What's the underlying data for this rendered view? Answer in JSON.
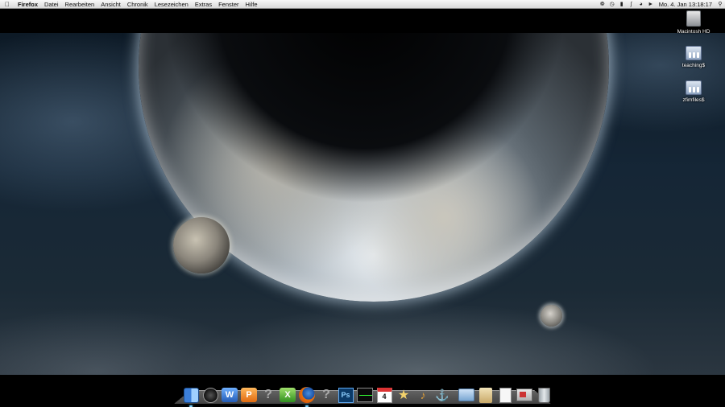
{
  "menubar": {
    "apple_icon": "apple-logo",
    "items": [
      {
        "label": "Firefox",
        "bold": true
      },
      {
        "label": "Datei"
      },
      {
        "label": "Rearbeiten"
      },
      {
        "label": "Ansicht"
      },
      {
        "label": "Chronik"
      },
      {
        "label": "Lesezeichen"
      },
      {
        "label": "Extras"
      },
      {
        "label": "Fenster"
      },
      {
        "label": "Hilfe"
      }
    ],
    "status_icons": [
      "script-icon",
      "time-machine-icon",
      "battery-icon",
      "bluetooth-icon",
      "wifi-icon",
      "volume-icon"
    ],
    "clock": "Mo. 4. Jan  13:18:17",
    "spotlight_icon": "spotlight-search-icon"
  },
  "desktop_icons": [
    {
      "label": "Macintosh HD",
      "icon": "hard-drive-icon"
    },
    {
      "label": "teaching$",
      "icon": "network-drive-icon"
    },
    {
      "label": "zfimfiles$",
      "icon": "network-drive-icon"
    }
  ],
  "dock": {
    "items": [
      {
        "name": "finder",
        "icon": "finder-icon",
        "running": true
      },
      {
        "name": "dashboard",
        "icon": "dashboard-icon",
        "running": false
      },
      {
        "name": "word",
        "icon": "word-icon",
        "glyph": "W",
        "running": false
      },
      {
        "name": "pages",
        "icon": "pages-icon",
        "glyph": "P",
        "running": false
      },
      {
        "name": "unknown-app-1",
        "icon": "question-mark-icon",
        "glyph": "?",
        "running": false
      },
      {
        "name": "excel",
        "icon": "excel-icon",
        "glyph": "X",
        "running": false
      },
      {
        "name": "firefox",
        "icon": "firefox-icon",
        "running": true
      },
      {
        "name": "unknown-app-2",
        "icon": "question-mark-icon",
        "glyph": "?",
        "running": false
      },
      {
        "name": "photoshop",
        "icon": "photoshop-icon",
        "glyph": "Ps",
        "running": false
      },
      {
        "name": "activity-monitor",
        "icon": "activity-monitor-icon",
        "running": false
      },
      {
        "name": "ical",
        "icon": "calendar-icon",
        "glyph": "4",
        "running": false
      },
      {
        "name": "imovie",
        "icon": "star-icon",
        "glyph": "★",
        "running": false
      },
      {
        "name": "garageband",
        "icon": "guitar-icon",
        "glyph": "♪",
        "running": false
      },
      {
        "name": "utility",
        "icon": "compass-icon",
        "glyph": "⚓",
        "running": false
      },
      {
        "name": "applications-folder",
        "icon": "folder-icon",
        "running": false
      },
      {
        "name": "documents-stack",
        "icon": "scroll-icon",
        "running": false
      },
      {
        "name": "document",
        "icon": "document-icon",
        "running": false
      },
      {
        "name": "preview",
        "icon": "preview-icon",
        "running": false
      },
      {
        "name": "trash",
        "icon": "trash-icon",
        "running": false
      }
    ]
  }
}
